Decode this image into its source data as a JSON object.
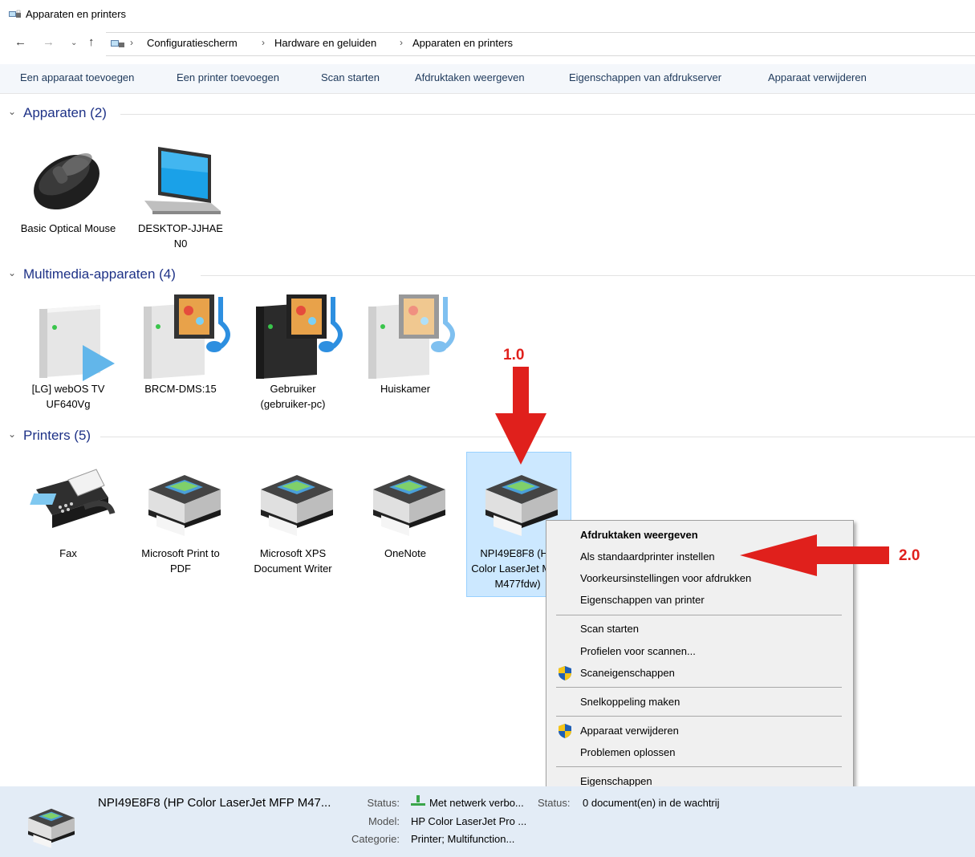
{
  "window": {
    "title": "Apparaten en printers"
  },
  "address": {
    "breadcrumbs": [
      "Configuratiescherm",
      "Hardware en geluiden",
      "Apparaten en printers"
    ]
  },
  "commands": [
    "Een apparaat toevoegen",
    "Een printer toevoegen",
    "Scan starten",
    "Afdruktaken weergeven",
    "Eigenschappen van afdrukserver",
    "Apparaat verwijderen"
  ],
  "groups": {
    "apparaten": {
      "title": "Apparaten (2)",
      "items": [
        {
          "label": "Basic Optical Mouse",
          "icon": "mouse-icon"
        },
        {
          "label": "DESKTOP-JJHAE N0",
          "icon": "laptop-icon"
        }
      ]
    },
    "multimedia": {
      "title": "Multimedia-apparaten (4)",
      "items": [
        {
          "label": "[LG] webOS TV UF640Vg",
          "icon": "media-server-icon"
        },
        {
          "label": "BRCM-DMS:15",
          "icon": "media-server-icon"
        },
        {
          "label": "Gebruiker (gebruiker-pc)",
          "icon": "media-server-icon"
        },
        {
          "label": "Huiskamer",
          "icon": "media-server-icon"
        }
      ]
    },
    "printers": {
      "title": "Printers (5)",
      "items": [
        {
          "label": "Fax",
          "icon": "fax-icon"
        },
        {
          "label": "Microsoft Print to PDF",
          "icon": "printer-icon"
        },
        {
          "label": "Microsoft XPS Document Writer",
          "icon": "printer-icon"
        },
        {
          "label": "OneNote",
          "icon": "printer-icon"
        },
        {
          "label": "NPI49E8F8 (HP Color LaserJet MFP M477fdw)",
          "icon": "printer-icon"
        }
      ]
    }
  },
  "context_menu": {
    "items": [
      "Afdruktaken weergeven",
      "Als standaardprinter instellen",
      "Voorkeursinstellingen voor afdrukken",
      "Eigenschappen van printer",
      "Scan starten",
      "Profielen voor scannen...",
      "Scaneigenschappen",
      "Snelkoppeling maken",
      "Apparaat verwijderen",
      "Problemen oplossen",
      "Eigenschappen"
    ]
  },
  "annotations": {
    "first": "1.0",
    "second": "2.0"
  },
  "details": {
    "title": "NPI49E8F8 (HP Color LaserJet MFP M47...",
    "status_key": "Status:",
    "status_value": "Met netwerk verbo...",
    "status2_key": "Status:",
    "status2_value": "0 document(en) in de wachtrij",
    "model_key": "Model:",
    "model_value": "HP Color LaserJet Pro ...",
    "category_key": "Categorie:",
    "category_value": "Printer; Multifunction..."
  },
  "colors": {
    "accent": "#1e3287",
    "selection": "#cce8ff",
    "annotation": "#e0201c",
    "details_bg": "#e3ecf6"
  }
}
